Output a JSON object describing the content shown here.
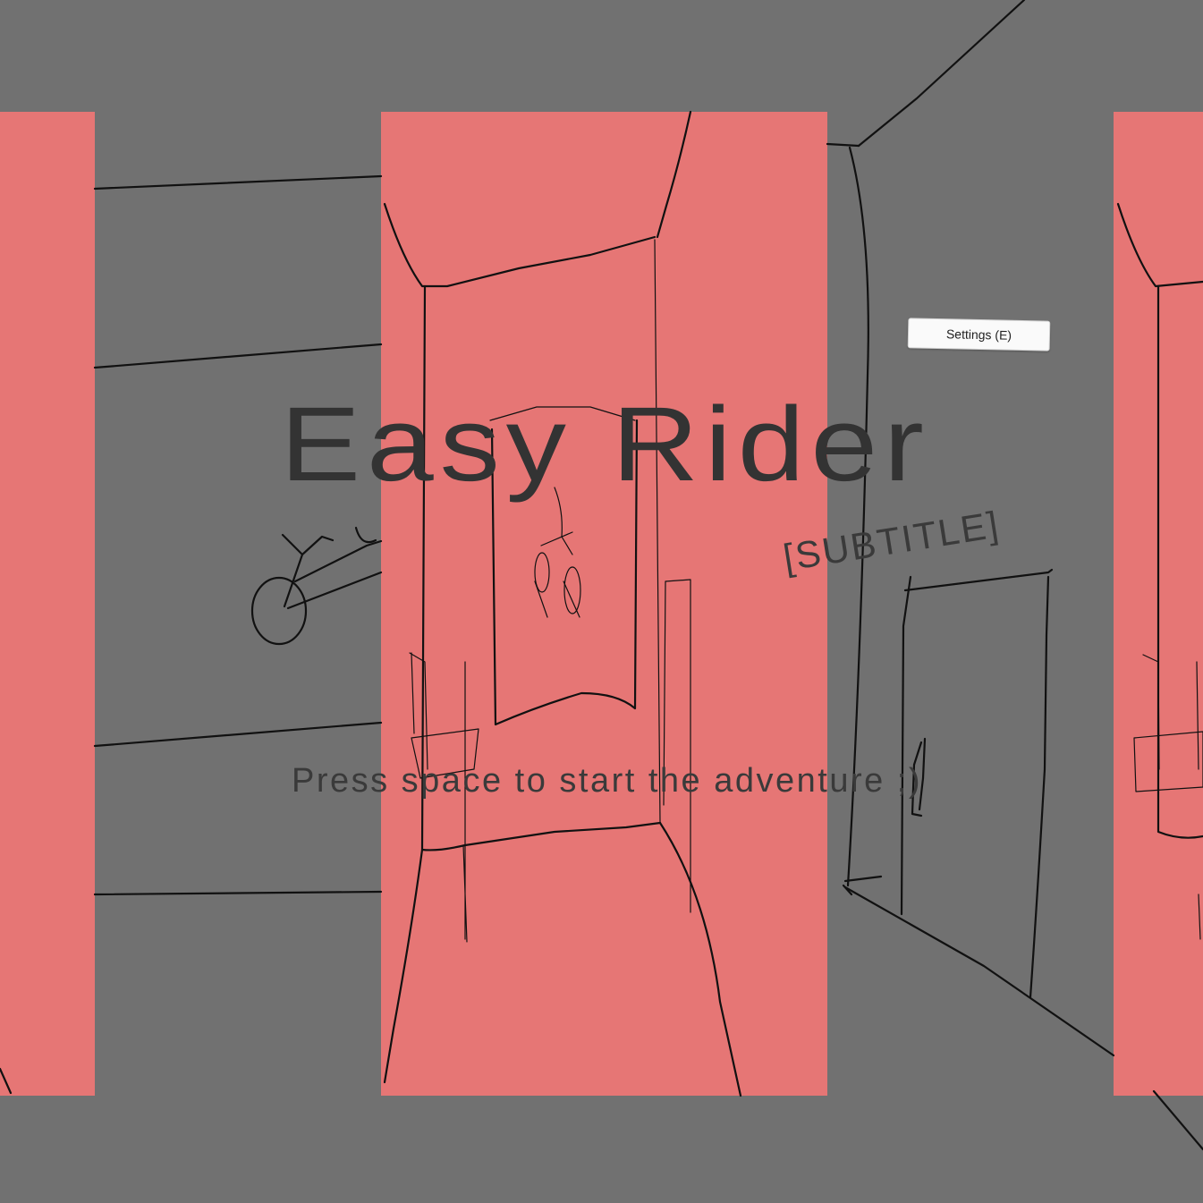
{
  "title": "Easy Rider",
  "subtitle": "[SUBTITLE]",
  "start_prompt": "Press space to start the adventure ;)",
  "settings_button": {
    "label": "Settings (E)"
  },
  "colors": {
    "background": "#717171",
    "panel": "#e67675",
    "title_text": "#333333",
    "button_bg": "#fafafa"
  }
}
